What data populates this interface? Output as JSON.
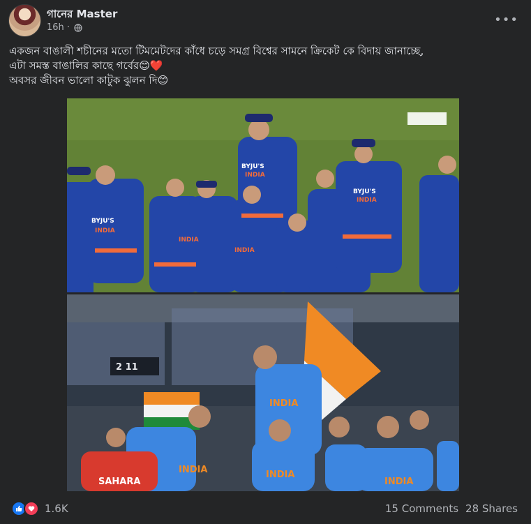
{
  "post": {
    "page_name": "গানের Master",
    "time": "16h ·",
    "caption_lines": [
      "একজন বাঙালী শচীনের মতো টিমমেটদের কাঁধে চড়ে সমগ্র বিশ্বের সামনে ক্রিকেট কে বিদায় জানাচ্ছে,",
      "এটা সমস্ত বাঙালির কাছে গর্বের😊❤️",
      "অবসর জীবন ভালো কাটুক ঝুলন দি😊"
    ]
  },
  "media": {
    "top_photo": {
      "jersey_texts": [
        "BYJU'S",
        "INDIA",
        "BYJU'S",
        "INDIA",
        "BYJU'S",
        "INDIA",
        "INDIA",
        "INDIA"
      ]
    },
    "bottom_photo": {
      "jersey_texts": [
        "INDIA",
        "INDIA",
        "INDIA",
        "SAHARA",
        "INDIA"
      ],
      "scoreboard": "2 11"
    }
  },
  "footer": {
    "reaction_count": "1.6K",
    "comments": "15 Comments",
    "shares": "28 Shares"
  },
  "colors": {
    "background": "#242526",
    "text_primary": "#e4e6eb",
    "text_secondary": "#b0b3b8",
    "like_blue": "#1877f2",
    "love_red": "#f33e58",
    "jersey_blue": "#2346a8"
  },
  "icons": [
    "globe-icon",
    "more-options-icon",
    "like-reaction-icon",
    "love-reaction-icon"
  ]
}
